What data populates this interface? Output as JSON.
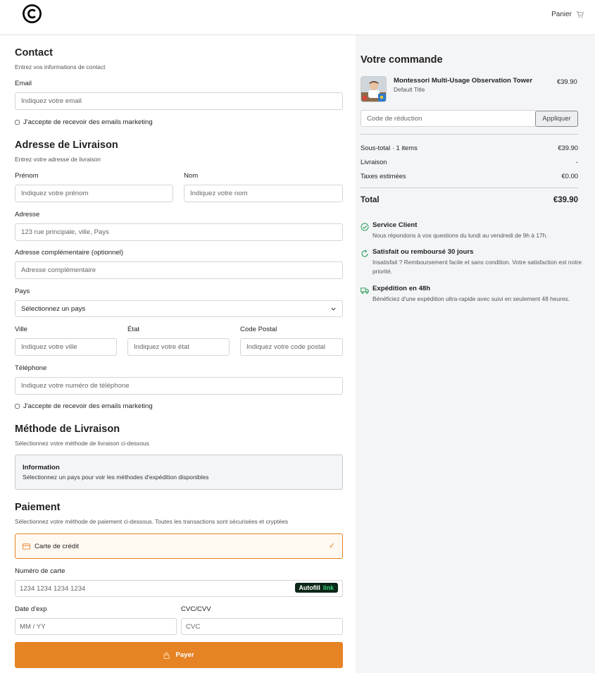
{
  "header": {
    "logo_name": "copyright-logo",
    "cart_label": "Panier"
  },
  "contact": {
    "title": "Contact",
    "subtitle": "Entrez vos informations de contact",
    "email_label": "Email",
    "email_placeholder": "Indiquez votre email",
    "marketing_label": "J'accepte de recevoir des emails marketing"
  },
  "shipping_address": {
    "title": "Adresse de Livraison",
    "subtitle": "Entrez votre adresse de livraison",
    "first_name_label": "Prénom",
    "first_name_placeholder": "Indiquez votre prénom",
    "last_name_label": "Nom",
    "last_name_placeholder": "Indiquez votre nom",
    "address_label": "Adresse",
    "address_placeholder": "123 rue principale, ville, Pays",
    "address2_label": "Adresse complémentaire (optionnel)",
    "address2_placeholder": "Adresse complémentaire",
    "country_label": "Pays",
    "country_value": "Sélectionnez un pays",
    "city_label": "Ville",
    "city_placeholder": "Indiquez votre ville",
    "state_label": "État",
    "state_placeholder": "Indiquez votre état",
    "zip_label": "Code Postal",
    "zip_placeholder": "Indiquez votre code postal",
    "phone_label": "Téléphone",
    "phone_placeholder": "Indiquez votre numéro de téléphone",
    "marketing_label": "J'accepte de recevoir des emails marketing"
  },
  "shipping_method": {
    "title": "Méthode de Livraison",
    "subtitle": "Sélectionnez votre méthode de livraison ci-dessous",
    "info_title": "Information",
    "info_text": "Sélectionnez un pays pour voir les méthodes d'expédition disponibles"
  },
  "payment": {
    "title": "Paiement",
    "subtitle": "Sélectionnez votre méthode de paiement ci-dessous. Toutes les transactions sont sécurisées et cryptées",
    "method_label": "Carte de crédit",
    "card_number_label": "Numéro de carte",
    "card_number_placeholder": "1234 1234 1234 1234",
    "autofill_label": "Autofill",
    "autofill_link": "link",
    "exp_label": "Date d'exp",
    "exp_placeholder": "MM / YY",
    "cvc_label": "CVC/CVV",
    "cvc_placeholder": "CVC",
    "pay_label": "Payer"
  },
  "order": {
    "title": "Votre commande",
    "product_name": "Montessori Multi-Usage Observation Tower",
    "product_variant": "Default Title",
    "product_price": "€39.90",
    "discount_placeholder": "Code de réduction",
    "apply_label": "Appliquer",
    "subtotal_label": "Sous-total · 1 items",
    "subtotal_value": "€39.90",
    "shipping_label": "Livraison",
    "shipping_value": "-",
    "taxes_label": "Taxes estimées",
    "taxes_value": "€0.00",
    "total_label": "Total",
    "total_value": "€39.90"
  },
  "features": [
    {
      "title": "Service Client",
      "text": "Nous répondons à vos questions du lundi au vendredi de 9h à 17h."
    },
    {
      "title": "Satisfait ou remboursé 30 jours",
      "text": "Insatisfait ? Remboursement facile et sans condition. Votre satisfaction est notre priorité."
    },
    {
      "title": "Expédition en 48h",
      "text": "Bénéficiez d'une expédition ultra-rapide avec suivi en seulement 48 heures."
    }
  ],
  "colors": {
    "accent": "#e58325",
    "feature_icon": "#2e9e5b",
    "link_green": "#35d07f"
  }
}
